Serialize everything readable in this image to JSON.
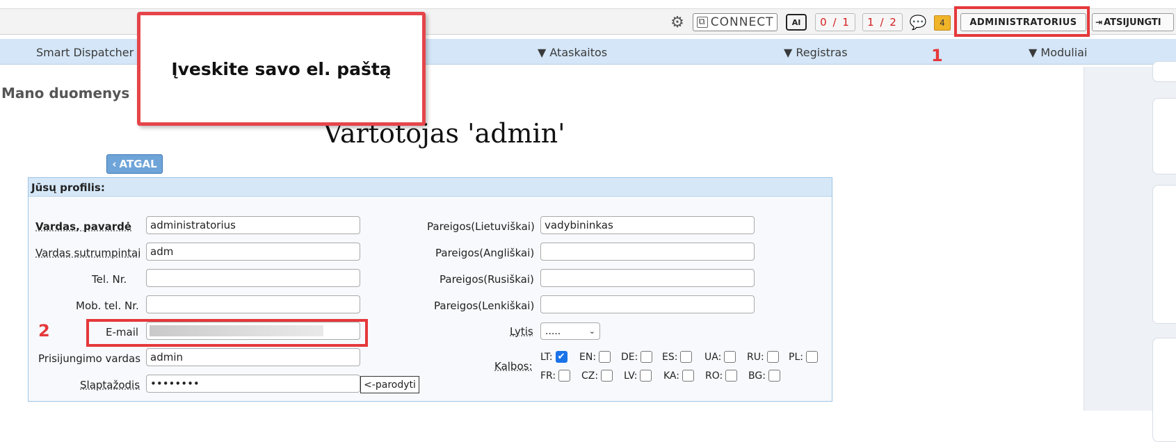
{
  "topbar": {
    "connect_label": "CONNECT",
    "ai_label": "AI",
    "counter1": "0 / 1",
    "counter2": "1 / 2",
    "notif_count": "4",
    "admin_label": "ADMINISTRATORIUS",
    "logout_label": "ATSIJUNGTI",
    "icons": [
      "gear-icon",
      "connect-icon",
      "ai-chip-icon",
      "chat-icon",
      "notification-icon",
      "logout-icon"
    ]
  },
  "menu": {
    "items": [
      "Smart Dispatcher",
      "▼ Ataskaitos",
      "▼ Registras",
      "▼ Moduliai"
    ]
  },
  "page": {
    "section_title": "Mano duomenys",
    "user_title": "Vartotojas 'admin'",
    "back_label": "ATGAL"
  },
  "profile": {
    "header": "Jūsų profilis:",
    "left_fields": [
      {
        "label": "Vardas, pavardė",
        "value": "administratorius"
      },
      {
        "label": "Vardas sutrumpintai",
        "value": "adm"
      },
      {
        "label": "Tel. Nr.",
        "value": ""
      },
      {
        "label": "Mob. tel. Nr.",
        "value": ""
      },
      {
        "label": "E-mail",
        "value": ""
      },
      {
        "label": "Prisijungimo vardas",
        "value": "admin"
      },
      {
        "label": "Slaptažodis",
        "value": "••••••••"
      }
    ],
    "show_password_label": "<-parodyti",
    "right_fields": [
      {
        "label": "Pareigos(Lietuviškai)",
        "value": "vadybininkas"
      },
      {
        "label": "Pareigos(Angliškai)",
        "value": ""
      },
      {
        "label": "Pareigos(Rusiškai)",
        "value": ""
      },
      {
        "label": "Pareigos(Lenkiškai)",
        "value": ""
      }
    ],
    "gender_label": "Lytis",
    "gender_value": ".....",
    "languages_label": "Kalbos:",
    "languages": [
      {
        "code": "LT:",
        "checked": true
      },
      {
        "code": "EN:",
        "checked": false
      },
      {
        "code": "DE:",
        "checked": false
      },
      {
        "code": "ES:",
        "checked": false
      },
      {
        "code": "UA:",
        "checked": false
      },
      {
        "code": "RU:",
        "checked": false
      },
      {
        "code": "PL:",
        "checked": false
      },
      {
        "code": "FR:",
        "checked": false
      },
      {
        "code": "CZ:",
        "checked": false
      },
      {
        "code": "LV:",
        "checked": false
      },
      {
        "code": "KA:",
        "checked": false
      },
      {
        "code": "RO:",
        "checked": false
      },
      {
        "code": "BG:",
        "checked": false
      }
    ]
  },
  "annotations": {
    "tooltip": "Įveskite savo el. paštą",
    "step1": "1",
    "step2": "2",
    "highlight_color": "#e5383b"
  }
}
